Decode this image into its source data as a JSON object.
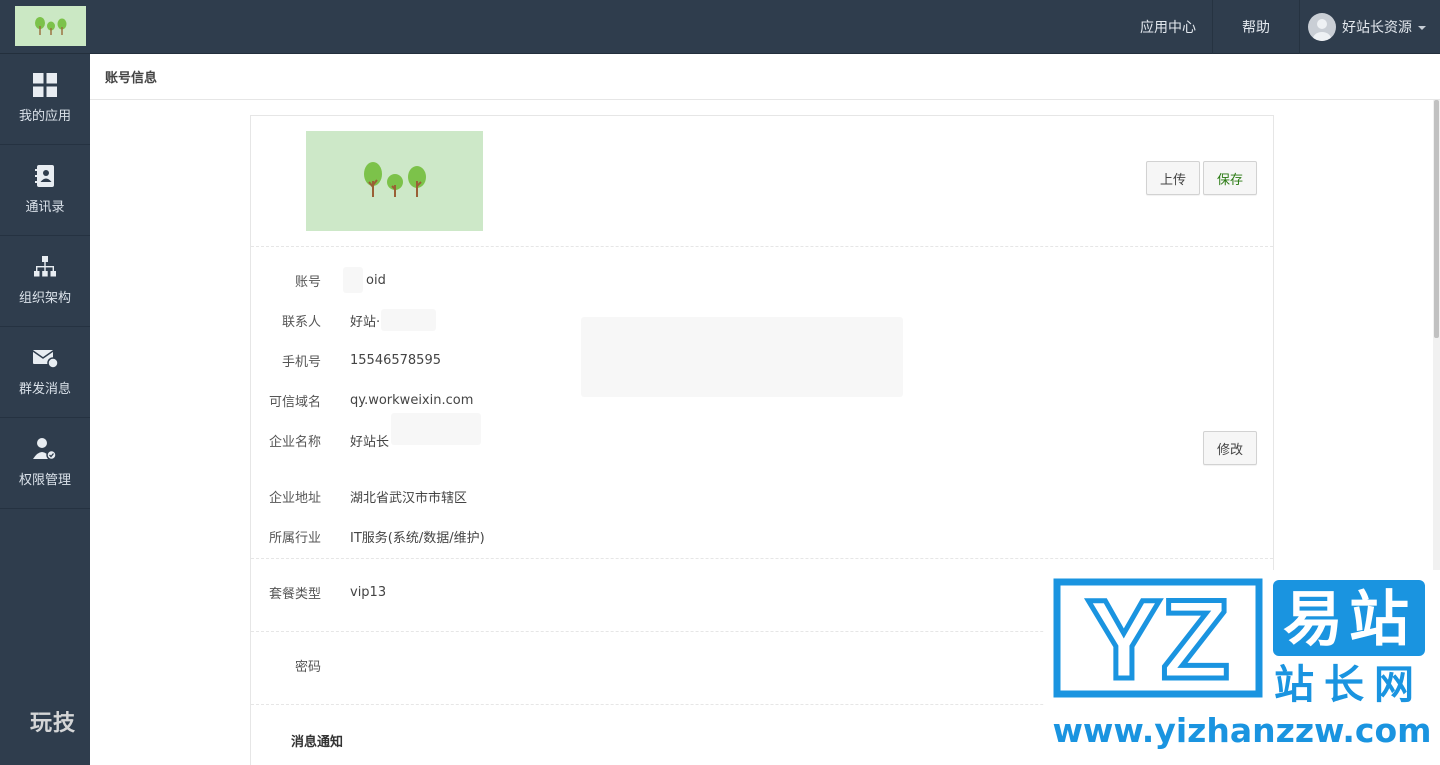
{
  "header": {
    "app_center": "应用中心",
    "help": "帮助",
    "user_name": "好站长资源"
  },
  "sidebar": {
    "items": [
      {
        "label": "我的应用",
        "icon": "grid-icon"
      },
      {
        "label": "通讯录",
        "icon": "contacts-icon"
      },
      {
        "label": "组织架构",
        "icon": "org-chart-icon"
      },
      {
        "label": "群发消息",
        "icon": "broadcast-message-icon"
      },
      {
        "label": "权限管理",
        "icon": "admin-permission-icon"
      }
    ],
    "watermark": "玩技"
  },
  "breadcrumb": "账号信息",
  "logo_section": {
    "upload_label": "上传",
    "save_label": "保存"
  },
  "account": {
    "account_label": "账号",
    "account_value": "oid",
    "contact_label": "联系人",
    "contact_value": "好站·",
    "phone_label": "手机号",
    "phone_value": "15546578595",
    "domain_label": "可信域名",
    "domain_value": "qy.workweixin.com",
    "company_label": "企业名称",
    "company_value": "好站长",
    "edit_label": "修改",
    "address_label": "企业地址",
    "address_value": "湖北省武汉市市辖区",
    "industry_label": "所属行业",
    "industry_value": "IT服务(系统/数据/维护)"
  },
  "plan": {
    "label": "套餐类型",
    "value": "vip13"
  },
  "password": {
    "label": "密码"
  },
  "notifications": {
    "title": "消息通知"
  },
  "watermark": {
    "logo_letters": "YZ",
    "brand_top": "易站",
    "brand_bottom": "站长网",
    "url": "www.yizhanzzw.com"
  },
  "colors": {
    "nav_bg": "#2f3d4d",
    "accent_green": "#2a7a12",
    "watermark_blue": "#1a94e0",
    "logo_bg": "#cde8c8"
  }
}
